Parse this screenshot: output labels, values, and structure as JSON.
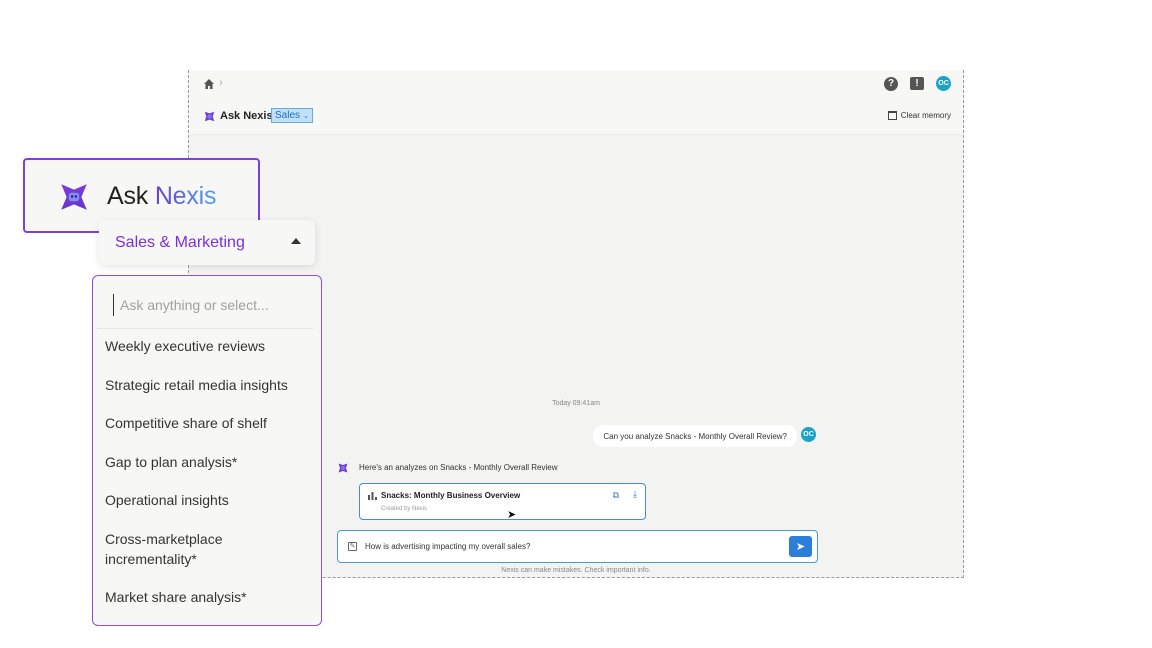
{
  "window": {
    "topbar": {
      "icons": [
        "home-icon",
        "chevron-right-icon",
        "help-icon",
        "feedback-icon"
      ],
      "avatar_initials": "OC"
    },
    "header": {
      "app_name": "Ask Nexis",
      "workspace_select": "Sales",
      "clear_memory_label": "Clear memory"
    },
    "chat": {
      "timestamp": "Today 09:41am",
      "user_message": "Can you analyze Snacks - Monthly Overall Review?",
      "user_avatar_initials": "OC",
      "bot_message": "Here's an analyzes on Snacks - Monthly Overall Review",
      "report_card": {
        "title": "Snacks: Monthly Business Overview",
        "subtitle": "Created by Nexis"
      },
      "composer_text": "How is advertising impacting my overall sales?",
      "disclaimer": "Nexis can make mistakes. Check important info."
    }
  },
  "zoom": {
    "brand_prefix": "Ask ",
    "brand_accent": "Nexis",
    "brand_colors": {
      "accent_from": "#6b3fd6",
      "accent_to": "#4ea3e6",
      "border": "#7b3fe4"
    },
    "workspace_label": "Sales & Marketing",
    "search_placeholder": "Ask anything or select...",
    "menu_items": [
      "Weekly executive reviews",
      "Strategic retail media insights",
      "Competitive share of shelf",
      "Gap to plan analysis*",
      "Operational insights",
      "Cross-marketplace incrementality*",
      "Market share analysis*"
    ]
  }
}
